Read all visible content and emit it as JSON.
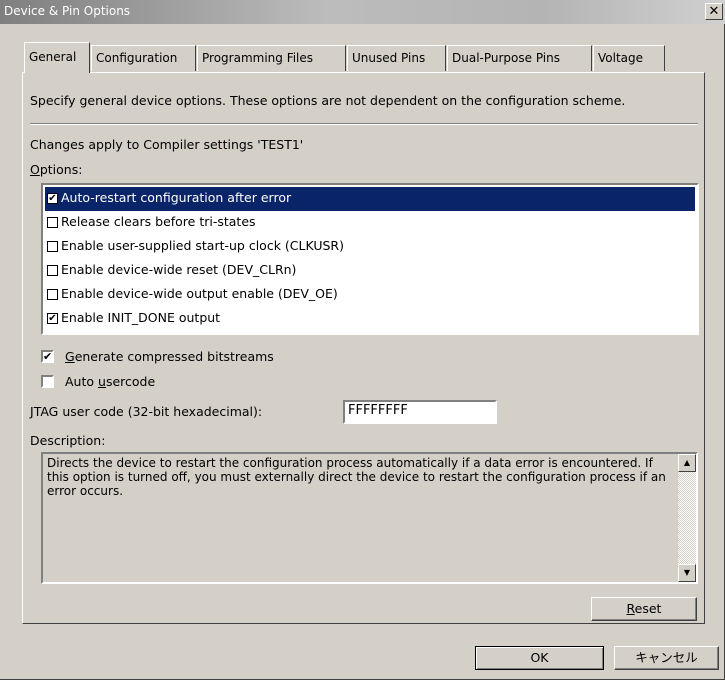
{
  "window": {
    "title": "Device & Pin Options",
    "close_glyph": "✕"
  },
  "tabs": [
    {
      "label": "General",
      "active": true
    },
    {
      "label": "Configuration",
      "active": false
    },
    {
      "label": "Programming Files",
      "active": false
    },
    {
      "label": "Unused Pins",
      "active": false
    },
    {
      "label": "Dual-Purpose Pins",
      "active": false
    },
    {
      "label": "Voltage",
      "active": false
    }
  ],
  "general": {
    "intro": "Specify general device options.  These options are not dependent on the configuration scheme.",
    "changes_note": "Changes apply to Compiler settings 'TEST1'",
    "options_label_u": "O",
    "options_label_rest": "ptions:",
    "options": [
      {
        "label": "Auto-restart configuration after error",
        "checked": true,
        "selected": true
      },
      {
        "label": "Release clears before tri-states",
        "checked": false,
        "selected": false
      },
      {
        "label": "Enable user-supplied start-up clock (CLKUSR)",
        "checked": false,
        "selected": false
      },
      {
        "label": "Enable device-wide reset (DEV_CLRn)",
        "checked": false,
        "selected": false
      },
      {
        "label": "Enable device-wide output enable (DEV_OE)",
        "checked": false,
        "selected": false
      },
      {
        "label": "Enable INIT_DONE output",
        "checked": true,
        "selected": false
      }
    ],
    "compressed_bitstreams": {
      "label_u": "G",
      "label_rest": "enerate compressed bitstreams",
      "checked": true
    },
    "auto_usercode": {
      "label_pre": "Auto ",
      "label_u": "u",
      "label_rest": "sercode",
      "checked": false
    },
    "jtag": {
      "label_u": "J",
      "label_rest": "TAG user code (32-bit hexadecimal):",
      "value": "FFFFFFFF"
    },
    "description_label": "Description:",
    "description_text": "Directs the device to restart the configuration process automatically if a data error is encountered. If this option is turned off, you must externally direct the device to restart the configuration process if an error occurs.",
    "reset_u": "R",
    "reset_rest": "eset"
  },
  "scroll_up_glyph": "▲",
  "scroll_down_glyph": "▼",
  "check_glyph": "✔",
  "footer": {
    "ok_label": "OK",
    "cancel_label": "キャンセル"
  }
}
